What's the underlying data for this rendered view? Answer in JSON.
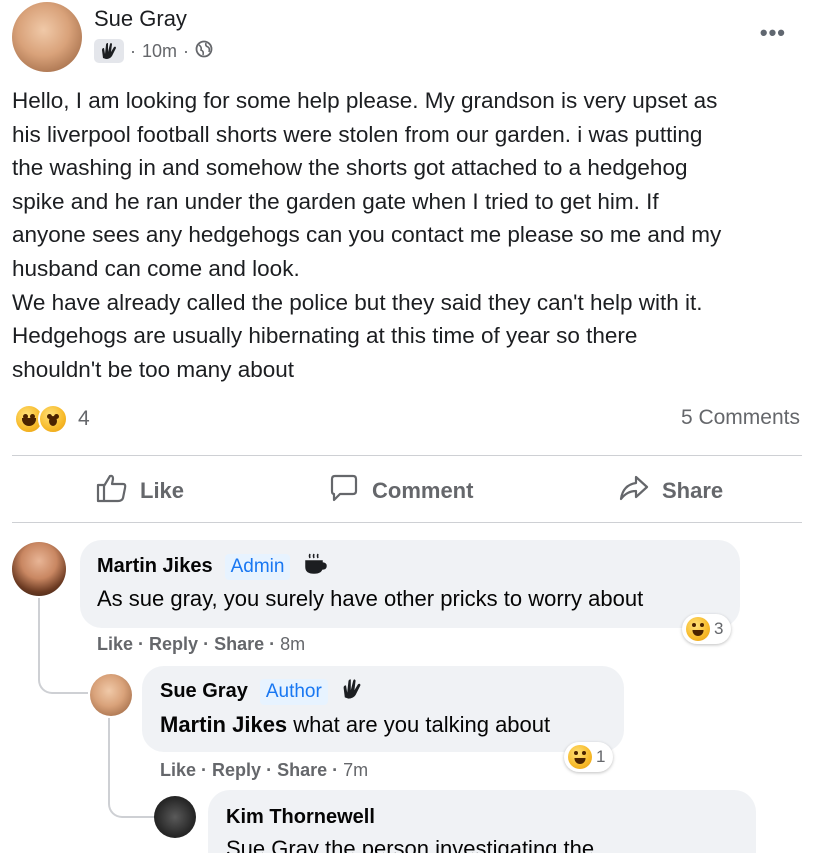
{
  "post": {
    "author": "Sue Gray",
    "time": "10m",
    "icons": [
      "wave-badge-icon",
      "globe-icon",
      "more-icon"
    ],
    "body_lines": [
      "Hello, I am looking for some help please. My grandson is very upset as",
      "his liverpool football shorts were stolen from our garden. i was putting",
      "the washing in and somehow the shorts got attached to a hedgehog",
      "spike and he ran under the garden gate when I tried to get him. If",
      "anyone sees any hedgehogs can you contact me please so me and my",
      "husband can come and look.",
      "We have already called the police but they said they can't help with it.",
      "Hedgehogs are usually hibernating at this time of year so there",
      "shouldn't be too many about"
    ],
    "reaction_count": "4",
    "comments_count": "5 Comments"
  },
  "actions": {
    "like": "Like",
    "comment": "Comment",
    "share": "Share"
  },
  "comments": [
    {
      "name": "Martin Jikes",
      "tag": "Admin",
      "text": "As sue gray, you surely have other pricks to worry about",
      "like": "Like",
      "reply": "Reply",
      "share": "Share",
      "time": "8m",
      "reactions": "3"
    },
    {
      "name": "Sue Gray",
      "tag": "Author",
      "mention": "Martin Jikes",
      "text": " what are you talking about",
      "like": "Like",
      "reply": "Reply",
      "share": "Share",
      "time": "7m",
      "reactions": "1"
    },
    {
      "name": "Kim Thornewell",
      "text": "Sue Gray the person investigating the"
    }
  ],
  "colors": {
    "link_blue": "#1877f2",
    "meta_gray": "#65676b",
    "bubble_bg": "#f0f2f5",
    "reaction_yellow": "#f7b928"
  }
}
